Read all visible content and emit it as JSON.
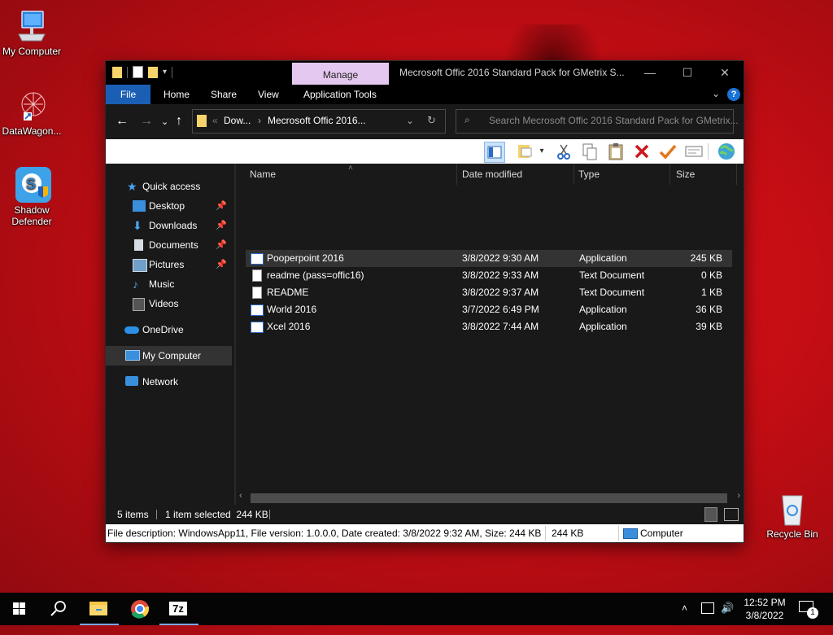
{
  "desktop": {
    "icons": [
      {
        "label": "My Computer"
      },
      {
        "label": "DataWagon..."
      },
      {
        "label": "Shadow\nDefender"
      },
      {
        "label": "Recycle Bin"
      }
    ]
  },
  "window": {
    "title": "Mecrosoft Offic 2016 Standard Pack for GMetrix S...",
    "context_tab": "Manage",
    "ribbon_tabs": [
      "File",
      "Home",
      "Share",
      "View",
      "Application Tools"
    ],
    "breadcrumb": [
      "Dow...",
      "Mecrosoft Offic 2016..."
    ],
    "search_placeholder": "Search Mecrosoft Offic 2016 Standard Pack for GMetrix...",
    "accent_color": "#1a5fb4"
  },
  "nav": {
    "quick_access": "Quick access",
    "items": [
      {
        "label": "Desktop",
        "pinned": true
      },
      {
        "label": "Downloads",
        "pinned": true
      },
      {
        "label": "Documents",
        "pinned": true
      },
      {
        "label": "Pictures",
        "pinned": true
      },
      {
        "label": "Music",
        "pinned": false
      },
      {
        "label": "Videos",
        "pinned": false
      }
    ],
    "onedrive": "OneDrive",
    "my_computer": "My Computer",
    "network": "Network"
  },
  "files": {
    "columns": [
      "Name",
      "Date modified",
      "Type",
      "Size"
    ],
    "rows": [
      {
        "name": "Pooperpoint 2016",
        "date": "3/8/2022 9:30 AM",
        "type": "Application",
        "size": "245 KB",
        "icon": "app-icon",
        "selected": true
      },
      {
        "name": "readme (pass=offic16)",
        "date": "3/8/2022 9:33 AM",
        "type": "Text Document",
        "size": "0 KB",
        "icon": "text-file-icon",
        "selected": false
      },
      {
        "name": "README",
        "date": "3/8/2022 9:37 AM",
        "type": "Text Document",
        "size": "1 KB",
        "icon": "text-file-icon",
        "selected": false
      },
      {
        "name": "World 2016",
        "date": "3/7/2022 6:49 PM",
        "type": "Application",
        "size": "36 KB",
        "icon": "app-icon",
        "selected": false
      },
      {
        "name": "Xcel 2016",
        "date": "3/8/2022 7:44 AM",
        "type": "Application",
        "size": "39 KB",
        "icon": "app-icon",
        "selected": false
      }
    ]
  },
  "status": {
    "count": "5 items",
    "selection": "1 item selected  244 KB",
    "description": "File description: WindowsApp11, File version: 1.0.0.0, Date created: 3/8/2022 9:32 AM, Size: 244 KB",
    "size": "244 KB",
    "location": "Computer"
  },
  "taskbar": {
    "time": "12:52 PM",
    "date": "3/8/2022",
    "notification_count": "1",
    "sevenzip_label": "7z"
  }
}
